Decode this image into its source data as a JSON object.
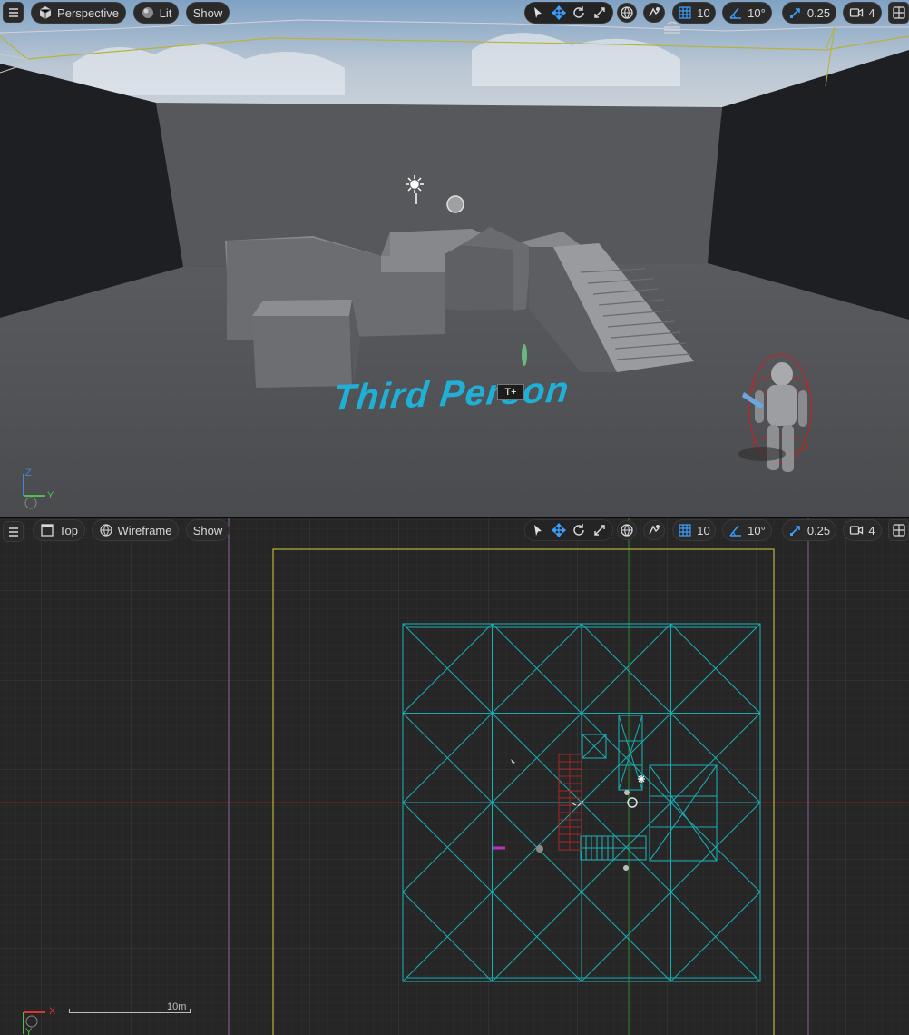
{
  "colors": {
    "toolbar_bg": "#2a2a2a",
    "icon_blue": "#3aa0ff",
    "wire_cyan": "#1aa9b0",
    "level_bounds_yellow": "#b8b23a",
    "axis_red": "#8a2020",
    "axis_green": "#2c8a2c",
    "text_color": "#1fb0d8"
  },
  "perspective_viewport": {
    "menu_icon": "hamburger-icon",
    "view_mode": "Perspective",
    "lighting_mode": "Lit",
    "show_label": "Show",
    "snap": {
      "grid_value": "10",
      "rotation_value": "10°",
      "scale_value": "0.25",
      "camera_speed": "4"
    },
    "scene_text": "Third Person",
    "axis": {
      "z": "Z",
      "y": "Y"
    }
  },
  "top_viewport": {
    "menu_icon": "hamburger-icon",
    "view_mode": "Top",
    "lighting_mode": "Wireframe",
    "show_label": "Show",
    "snap": {
      "grid_value": "10",
      "rotation_value": "10°",
      "scale_value": "0.25",
      "camera_speed": "4"
    },
    "axis": {
      "x": "X",
      "y": "Y"
    },
    "scale_bar_label": "10m"
  }
}
